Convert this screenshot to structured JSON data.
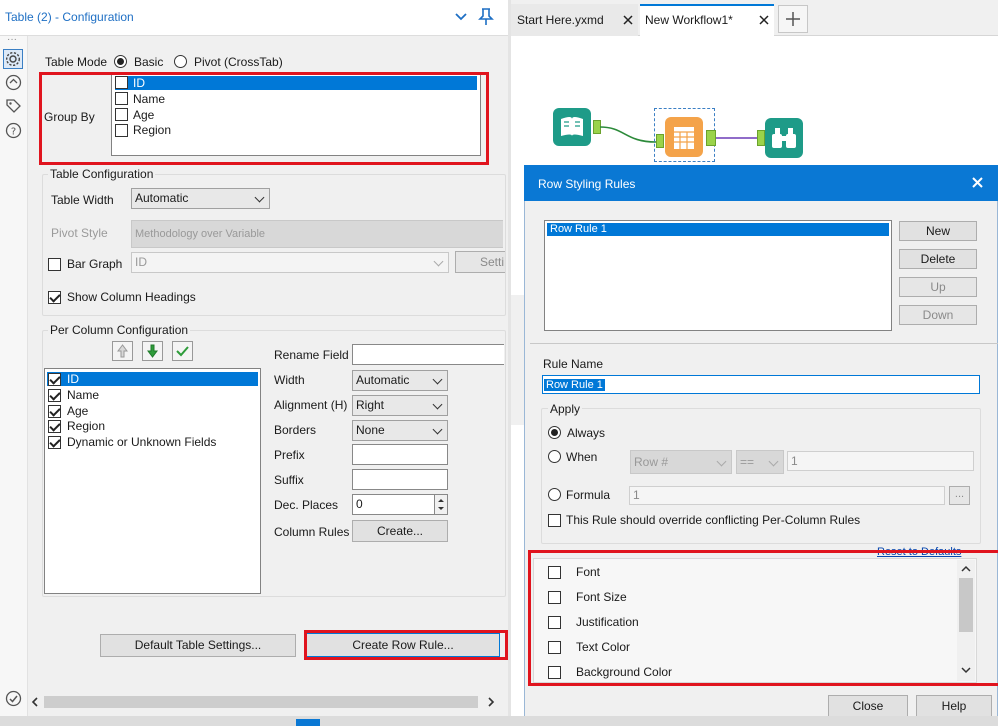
{
  "left_panel": {
    "title": "Table (2) - Configuration",
    "table_mode_label": "Table Mode",
    "mode_basic": "Basic",
    "mode_pivot": "Pivot (CrossTab)",
    "group_by_label": "Group By",
    "group_by_items": [
      "ID",
      "Name",
      "Age",
      "Region"
    ],
    "table_config_title": "Table Configuration",
    "table_width_label": "Table Width",
    "table_width_value": "Automatic",
    "pivot_style_label": "Pivot Style",
    "pivot_style_value": "Methodology over Variable",
    "bar_graph_label": "Bar Graph",
    "bar_graph_value": "ID",
    "settings_button": "Setti",
    "show_headings_label": "Show Column Headings",
    "per_column_title": "Per Column Configuration",
    "column_items": [
      "ID",
      "Name",
      "Age",
      "Region",
      "Dynamic or Unknown Fields"
    ],
    "rename_field_label": "Rename Field",
    "width_label": "Width",
    "width_value": "Automatic",
    "alignment_label": "Alignment (H)",
    "alignment_value": "Right",
    "borders_label": "Borders",
    "borders_value": "None",
    "prefix_label": "Prefix",
    "suffix_label": "Suffix",
    "dec_places_label": "Dec. Places",
    "dec_places_value": "0",
    "column_rules_label": "Column Rules",
    "create_button": "Create...",
    "default_settings_button": "Default Table Settings...",
    "create_row_rule_button": "Create Row Rule..."
  },
  "tabs": [
    {
      "label": "Start Here.yxmd"
    },
    {
      "label": "New Workflow1*"
    }
  ],
  "dialog": {
    "title": "Row Styling Rules",
    "rules": [
      "Row Rule 1"
    ],
    "new_button": "New",
    "delete_button": "Delete",
    "up_button": "Up",
    "down_button": "Down",
    "rule_name_label": "Rule Name",
    "rule_name_value": "Row Rule 1",
    "apply_label": "Apply",
    "always_label": "Always",
    "when_label": "When",
    "when_field": "Row #",
    "when_op": "==",
    "when_value": "1",
    "formula_label": "Formula",
    "formula_value": "1",
    "ellipsis": "...",
    "override_label": "This Rule should override conflicting Per-Column Rules",
    "reset_link": "Reset to Defaults",
    "style_options": [
      "Font",
      "Font Size",
      "Justification",
      "Text Color",
      "Background Color"
    ],
    "close_button": "Close",
    "help_button": "Help"
  },
  "colors": {
    "accent": "#0078d7",
    "title_blue": "#1e6fc4",
    "highlight_red": "#e0141e",
    "dialog_header": "#0a78d4"
  }
}
